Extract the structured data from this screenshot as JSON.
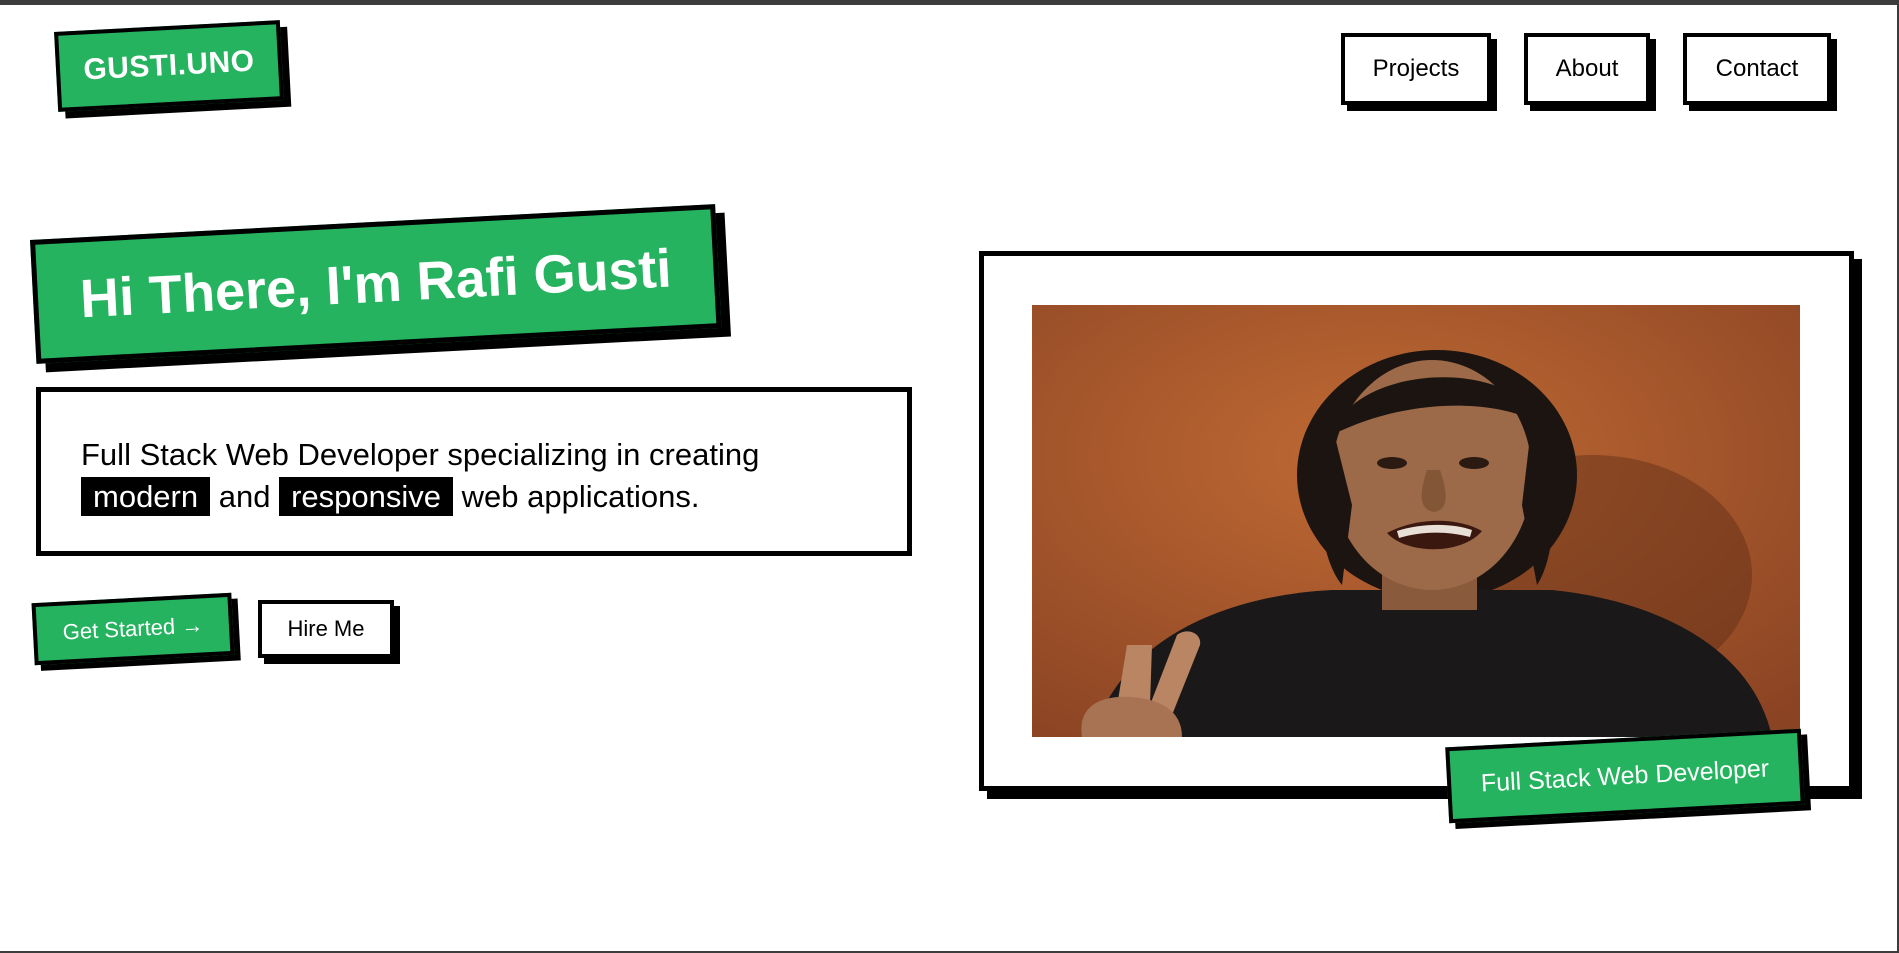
{
  "brand": {
    "logo_text": "GUSTI.UNO",
    "accent_color": "#25b35f"
  },
  "nav": {
    "items": [
      {
        "label": "Projects"
      },
      {
        "label": "About"
      },
      {
        "label": "Contact"
      }
    ]
  },
  "hero": {
    "title": "Hi There, I'm Rafi Gusti",
    "description": {
      "line1": "Full Stack Web Developer specializing in creating",
      "highlight1": "modern",
      "connector": "and",
      "highlight2": "responsive",
      "tail": "web applications."
    },
    "cta_primary": "Get Started →",
    "cta_secondary": "Hire Me"
  },
  "profile": {
    "role_badge": "Full Stack Web Developer"
  }
}
